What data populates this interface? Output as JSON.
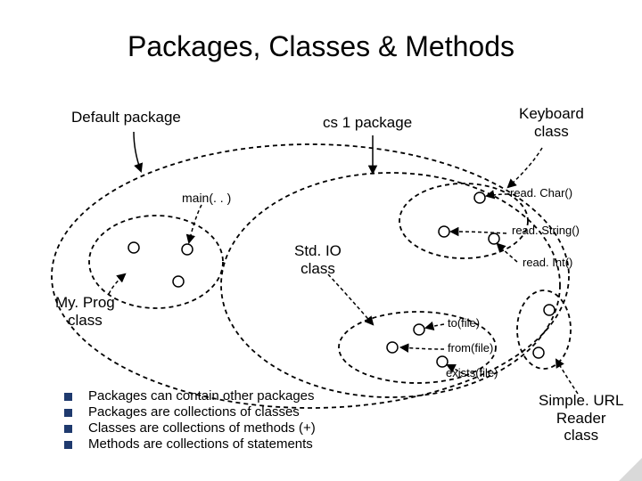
{
  "title": "Packages, Classes & Methods",
  "labels": {
    "default_package": "Default package",
    "cs1_package": "cs 1 package",
    "keyboard_class": "Keyboard\nclass",
    "main": "main(. . )",
    "stdio_class": "Std. IO\nclass",
    "myprog_class": "My. Prog\nclass",
    "readChar": "read. Char()",
    "readString": "read. String()",
    "readInt": "read. Int()",
    "toFile": "to(file)",
    "fromFile": "from(file)",
    "existsFile": "exists(file)",
    "simpleurl": "Simple. URL\nReader\nclass"
  },
  "bullets": [
    "Packages can contain other packages",
    "Packages are collections of classes",
    "Classes are collections of methods (+)",
    "Methods are collections of statements"
  ]
}
